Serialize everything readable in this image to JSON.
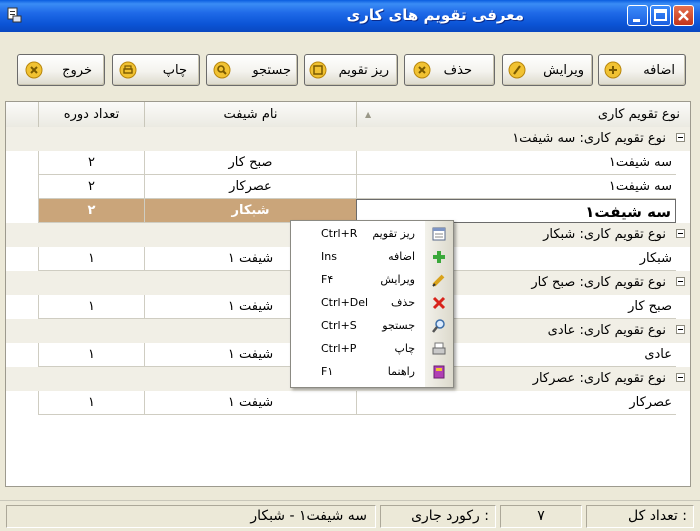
{
  "window": {
    "title": "معرفی تقویم های کاری"
  },
  "toolbar": {
    "add_label": "اضافه",
    "edit_label": "ویرایش",
    "delete_label": "حذف",
    "details_label": "ریز تقویم",
    "search_label": "جستجو",
    "print_label": "چاپ",
    "exit_label": "خروج"
  },
  "grid": {
    "columns": {
      "calendar_type": "نوع تقویم کاری",
      "shift_name": "نام شیفت",
      "period_count": "تعداد دوره"
    },
    "group_prefix": "نوع تقویم کاری:",
    "groups": [
      {
        "name": "سه شیفت۱",
        "rows": [
          {
            "type": "سه شیفت۱",
            "shift": "صبح کار",
            "count": "۲"
          },
          {
            "type": "سه شیفت۱",
            "shift": "عصرکار",
            "count": "۲"
          },
          {
            "type": "سه شیفت۱",
            "shift": "شبکار",
            "count": "۲"
          }
        ]
      },
      {
        "name": "شبکار",
        "rows": [
          {
            "type": "شبکار",
            "shift": "شیفت ۱",
            "count": "۱"
          }
        ]
      },
      {
        "name": "صبح کار",
        "rows": [
          {
            "type": "صبح کار",
            "shift": "شیفت ۱",
            "count": "۱"
          }
        ]
      },
      {
        "name": "عادی",
        "rows": [
          {
            "type": "عادی",
            "shift": "شیفت ۱",
            "count": "۱"
          }
        ]
      },
      {
        "name": "عصرکار",
        "rows": [
          {
            "type": "عصرکار",
            "shift": "شیفت ۱",
            "count": "۱"
          }
        ]
      }
    ]
  },
  "context_menu": {
    "items": [
      {
        "label": "ریز تقویم",
        "shortcut": "Ctrl+R",
        "icon": "calendar-icon"
      },
      {
        "label": "اضافه",
        "shortcut": "Ins",
        "icon": "plus-icon"
      },
      {
        "label": "ویرایش",
        "shortcut": "F۴",
        "icon": "pencil-icon"
      },
      {
        "label": "حذف",
        "shortcut": "Ctrl+Del",
        "icon": "delete-x-icon"
      },
      {
        "label": "جستجو",
        "shortcut": "Ctrl+S",
        "icon": "magnifier-icon"
      },
      {
        "label": "چاپ",
        "shortcut": "Ctrl+P",
        "icon": "printer-icon"
      },
      {
        "label": "راهنما",
        "shortcut": "F۱",
        "icon": "help-book-icon"
      }
    ]
  },
  "status": {
    "total_label": "تعداد کل :",
    "total_value": "۷",
    "current_label": "رکورد جاری :",
    "current_value": "سه شیفت۱ - شبکار"
  },
  "colors": {
    "titlebar": "#0a5ddf",
    "selected_row": "#caa57a",
    "group_row": "#f1efe6"
  }
}
